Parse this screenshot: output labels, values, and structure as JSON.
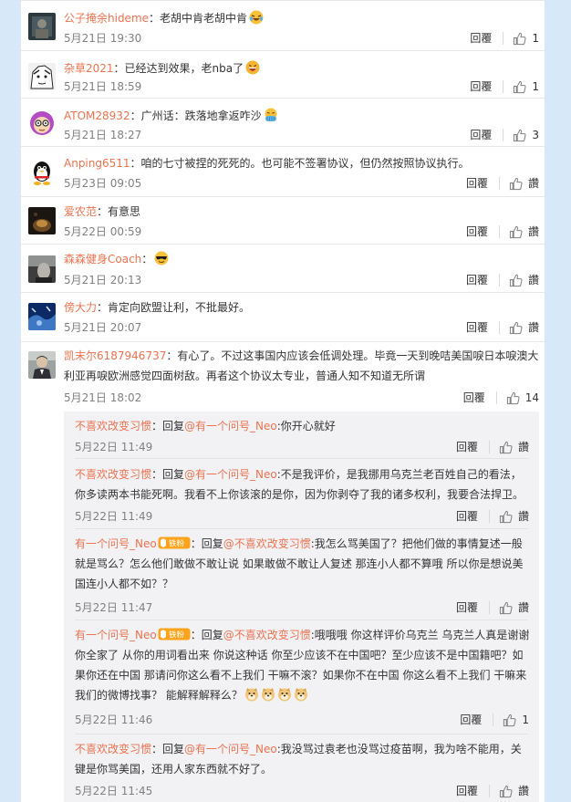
{
  "comments": [
    {
      "user": "公子掩余hideme",
      "text": "：老胡中肯老胡中肯",
      "emoji": "laugh-cry-emoji",
      "time": "5月21日 19:30",
      "reply": "回覆",
      "likes": "1"
    },
    {
      "user": "杂草2021",
      "text": "：已经达到效果，老nba了",
      "emoji": "grin-emoji",
      "time": "5月21日 18:59",
      "reply": "回覆",
      "likes": "1"
    },
    {
      "user": "ATOM28932",
      "text": "：广州话：跌落地拿返咋沙",
      "emoji": "facepalm-emoji",
      "time": "5月21日 18:27",
      "reply": "回覆",
      "likes": "3"
    },
    {
      "user": "Anping6511",
      "text": "：咱的七寸被捏的死死的。也可能不签署协议，但仍然按照协议执行。",
      "time": "5月23日 09:05",
      "reply": "回覆",
      "likes": "讚"
    },
    {
      "user": "爱农范",
      "text": "：有意思",
      "time": "5月22日 00:59",
      "reply": "回覆",
      "likes": "讚"
    },
    {
      "user": "森森健身Coach",
      "text": "：",
      "emoji": "sunglasses-emoji",
      "time": "5月21日 20:13",
      "reply": "回覆",
      "likes": "讚"
    },
    {
      "user": "傍大力",
      "text": "：肯定向欧盟让利，不批最好。",
      "time": "5月21日 20:07",
      "reply": "回覆",
      "likes": "讚"
    },
    {
      "user": "凯末尔6187946737",
      "text": "：有心了。不过这事国内应该会低调处理。毕竟一天到晚咭美国唳日本唳澳大利亚再唳欧洲感觉四面树敌。再者这个协议太专业，普通人知不知道无所谓",
      "time": "5月21日 18:02",
      "reply": "回覆",
      "likes": "14"
    }
  ],
  "replies": [
    {
      "user": "不喜欢改变习惯",
      "prefix": "：回复",
      "mention": "@有一个问号_Neo",
      "text": ":你开心就好",
      "time": "5月22日 11:49",
      "reply": "回覆",
      "likes": "讚"
    },
    {
      "user": "不喜欢改变习惯",
      "prefix": "：回复",
      "mention": "@有一个问号_Neo",
      "text": ":不是我评价，是我挪用乌克兰老百姓自己的看法，你多读两本书能死啊。我看不上你该滚的是你，因为你剥夺了我的诸多权利，我要合法捍卫。",
      "time": "5月22日 11:49",
      "reply": "回覆",
      "likes": "讚"
    },
    {
      "user": "有一个问号_Neo",
      "badge": "铁粉",
      "prefix": "：回复",
      "mention": "@不喜欢改变习惯",
      "text": ":我怎么骂美国了？把他们做的事情复述一般就是骂么？怎么他们敢做不敢让说 如果敢做不敢让人复述 那连小人都不算哦 所以你是想说美国连小人都不如？？",
      "time": "5月22日 11:47",
      "reply": "回覆",
      "likes": "讚"
    },
    {
      "user": "有一个问号_Neo",
      "badge": "铁粉",
      "prefix": "：回复",
      "mention": "@不喜欢改变习惯",
      "text": ":哦哦哦 你这样评价乌克兰 乌克兰人真是谢谢你全家了 从你的用词看出来 你说这种话 你至少应该不在中国吧？至少应该不是中国籍吧？如果你还在中国 那请问你这么看不上我们 干嘛不滚？如果你不在中国 你这么看不上我们 干嘛来我们的微博找事？ 能解释解释么？",
      "emojis": [
        "doge-emoji",
        "doge-emoji",
        "doge-emoji",
        "doge-emoji"
      ],
      "time": "5月22日 11:46",
      "reply": "回覆",
      "likes": "1"
    },
    {
      "user": "不喜欢改变习惯",
      "prefix": "：回复",
      "mention": "@有一个问号_Neo",
      "text": ":我没骂过袁老也没骂过疫苗啊，我为啥不能用，关键是你骂美国，还用人家东西就不好了。",
      "time": "5月22日 11:45",
      "reply": "回覆",
      "likes": "讚"
    }
  ],
  "colors": {
    "username": "#eb7350",
    "time": "#808080",
    "text": "#333333",
    "background": "#d7e9f8"
  }
}
